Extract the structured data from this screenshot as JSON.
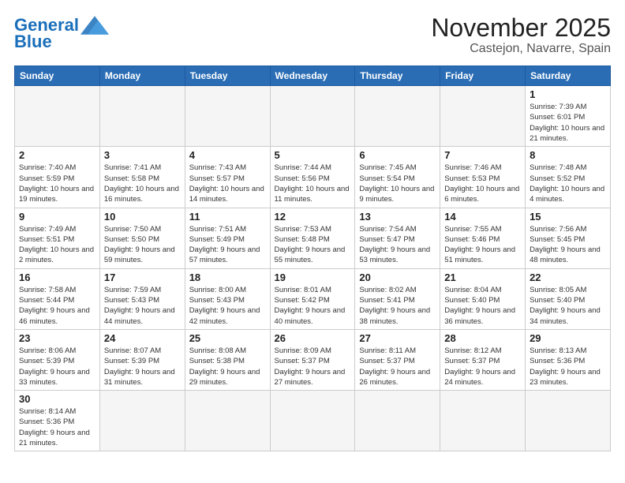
{
  "logo": {
    "text_general": "General",
    "text_blue": "Blue"
  },
  "title": "November 2025",
  "subtitle": "Castejon, Navarre, Spain",
  "days_of_week": [
    "Sunday",
    "Monday",
    "Tuesday",
    "Wednesday",
    "Thursday",
    "Friday",
    "Saturday"
  ],
  "weeks": [
    [
      {
        "day": "",
        "info": ""
      },
      {
        "day": "",
        "info": ""
      },
      {
        "day": "",
        "info": ""
      },
      {
        "day": "",
        "info": ""
      },
      {
        "day": "",
        "info": ""
      },
      {
        "day": "",
        "info": ""
      },
      {
        "day": "1",
        "info": "Sunrise: 7:39 AM\nSunset: 6:01 PM\nDaylight: 10 hours and 21 minutes."
      }
    ],
    [
      {
        "day": "2",
        "info": "Sunrise: 7:40 AM\nSunset: 5:59 PM\nDaylight: 10 hours and 19 minutes."
      },
      {
        "day": "3",
        "info": "Sunrise: 7:41 AM\nSunset: 5:58 PM\nDaylight: 10 hours and 16 minutes."
      },
      {
        "day": "4",
        "info": "Sunrise: 7:43 AM\nSunset: 5:57 PM\nDaylight: 10 hours and 14 minutes."
      },
      {
        "day": "5",
        "info": "Sunrise: 7:44 AM\nSunset: 5:56 PM\nDaylight: 10 hours and 11 minutes."
      },
      {
        "day": "6",
        "info": "Sunrise: 7:45 AM\nSunset: 5:54 PM\nDaylight: 10 hours and 9 minutes."
      },
      {
        "day": "7",
        "info": "Sunrise: 7:46 AM\nSunset: 5:53 PM\nDaylight: 10 hours and 6 minutes."
      },
      {
        "day": "8",
        "info": "Sunrise: 7:48 AM\nSunset: 5:52 PM\nDaylight: 10 hours and 4 minutes."
      }
    ],
    [
      {
        "day": "9",
        "info": "Sunrise: 7:49 AM\nSunset: 5:51 PM\nDaylight: 10 hours and 2 minutes."
      },
      {
        "day": "10",
        "info": "Sunrise: 7:50 AM\nSunset: 5:50 PM\nDaylight: 9 hours and 59 minutes."
      },
      {
        "day": "11",
        "info": "Sunrise: 7:51 AM\nSunset: 5:49 PM\nDaylight: 9 hours and 57 minutes."
      },
      {
        "day": "12",
        "info": "Sunrise: 7:53 AM\nSunset: 5:48 PM\nDaylight: 9 hours and 55 minutes."
      },
      {
        "day": "13",
        "info": "Sunrise: 7:54 AM\nSunset: 5:47 PM\nDaylight: 9 hours and 53 minutes."
      },
      {
        "day": "14",
        "info": "Sunrise: 7:55 AM\nSunset: 5:46 PM\nDaylight: 9 hours and 51 minutes."
      },
      {
        "day": "15",
        "info": "Sunrise: 7:56 AM\nSunset: 5:45 PM\nDaylight: 9 hours and 48 minutes."
      }
    ],
    [
      {
        "day": "16",
        "info": "Sunrise: 7:58 AM\nSunset: 5:44 PM\nDaylight: 9 hours and 46 minutes."
      },
      {
        "day": "17",
        "info": "Sunrise: 7:59 AM\nSunset: 5:43 PM\nDaylight: 9 hours and 44 minutes."
      },
      {
        "day": "18",
        "info": "Sunrise: 8:00 AM\nSunset: 5:43 PM\nDaylight: 9 hours and 42 minutes."
      },
      {
        "day": "19",
        "info": "Sunrise: 8:01 AM\nSunset: 5:42 PM\nDaylight: 9 hours and 40 minutes."
      },
      {
        "day": "20",
        "info": "Sunrise: 8:02 AM\nSunset: 5:41 PM\nDaylight: 9 hours and 38 minutes."
      },
      {
        "day": "21",
        "info": "Sunrise: 8:04 AM\nSunset: 5:40 PM\nDaylight: 9 hours and 36 minutes."
      },
      {
        "day": "22",
        "info": "Sunrise: 8:05 AM\nSunset: 5:40 PM\nDaylight: 9 hours and 34 minutes."
      }
    ],
    [
      {
        "day": "23",
        "info": "Sunrise: 8:06 AM\nSunset: 5:39 PM\nDaylight: 9 hours and 33 minutes."
      },
      {
        "day": "24",
        "info": "Sunrise: 8:07 AM\nSunset: 5:39 PM\nDaylight: 9 hours and 31 minutes."
      },
      {
        "day": "25",
        "info": "Sunrise: 8:08 AM\nSunset: 5:38 PM\nDaylight: 9 hours and 29 minutes."
      },
      {
        "day": "26",
        "info": "Sunrise: 8:09 AM\nSunset: 5:37 PM\nDaylight: 9 hours and 27 minutes."
      },
      {
        "day": "27",
        "info": "Sunrise: 8:11 AM\nSunset: 5:37 PM\nDaylight: 9 hours and 26 minutes."
      },
      {
        "day": "28",
        "info": "Sunrise: 8:12 AM\nSunset: 5:37 PM\nDaylight: 9 hours and 24 minutes."
      },
      {
        "day": "29",
        "info": "Sunrise: 8:13 AM\nSunset: 5:36 PM\nDaylight: 9 hours and 23 minutes."
      }
    ],
    [
      {
        "day": "30",
        "info": "Sunrise: 8:14 AM\nSunset: 5:36 PM\nDaylight: 9 hours and 21 minutes."
      },
      {
        "day": "",
        "info": ""
      },
      {
        "day": "",
        "info": ""
      },
      {
        "day": "",
        "info": ""
      },
      {
        "day": "",
        "info": ""
      },
      {
        "day": "",
        "info": ""
      },
      {
        "day": "",
        "info": ""
      }
    ]
  ]
}
